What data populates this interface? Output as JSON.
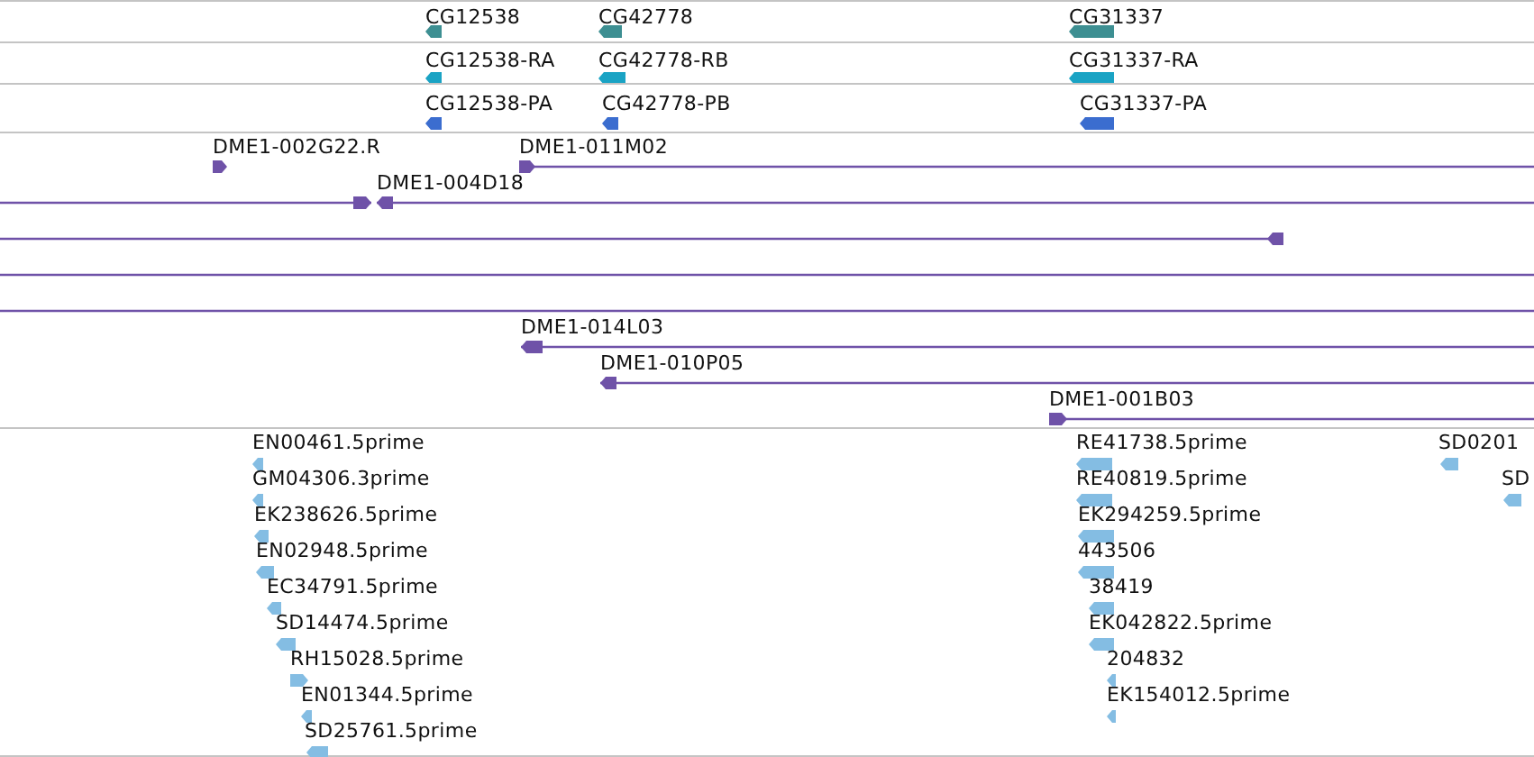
{
  "tracks": [
    {
      "kind": "gene",
      "features": [
        {
          "label": "CG12538",
          "reverse": true
        },
        {
          "label": "CG42778",
          "reverse": true
        },
        {
          "label": "CG31337",
          "reverse": true
        }
      ]
    },
    {
      "kind": "transcript",
      "features": [
        {
          "label": "CG12538-RA",
          "reverse": true
        },
        {
          "label": "CG42778-RB",
          "reverse": true
        },
        {
          "label": "CG31337-RA",
          "reverse": true
        }
      ]
    },
    {
      "kind": "protein",
      "features": [
        {
          "label": "CG12538-PA",
          "reverse": true
        },
        {
          "label": "CG42778-PB",
          "reverse": true
        },
        {
          "label": "CG31337-PA",
          "reverse": true
        }
      ]
    },
    {
      "kind": "clone",
      "features": [
        {
          "kind": "arrow",
          "label": "DME1-002G22.R",
          "reverse": false
        },
        {
          "kind": "arrow",
          "label": "DME1-011M02",
          "reverse": false
        },
        {
          "kind": "arrow",
          "reverse": false
        },
        {
          "kind": "arrow",
          "label": "DME1-004D18",
          "reverse": true
        },
        {
          "kind": "arrow",
          "reverse": true
        },
        {
          "kind": "line"
        },
        {
          "kind": "line"
        },
        {
          "kind": "arrow",
          "label": "DME1-014L03",
          "reverse": true
        },
        {
          "kind": "arrow",
          "label": "DME1-010P05",
          "reverse": true
        },
        {
          "kind": "arrow",
          "label": "DME1-001B03",
          "reverse": false
        }
      ]
    },
    {
      "kind": "est",
      "features": [
        {
          "label": "EN00461.5prime",
          "reverse": true
        },
        {
          "label": "GM04306.3prime",
          "reverse": true
        },
        {
          "label": "EK238626.5prime",
          "reverse": true
        },
        {
          "label": "EN02948.5prime",
          "reverse": true
        },
        {
          "label": "EC34791.5prime",
          "reverse": true
        },
        {
          "label": "SD14474.5prime",
          "reverse": true
        },
        {
          "label": "RH15028.5prime",
          "reverse": false
        },
        {
          "label": "EN01344.5prime",
          "reverse": true
        },
        {
          "label": "SD25761.5prime",
          "reverse": true
        },
        {
          "label": "RE41738.5prime",
          "reverse": true
        },
        {
          "label": "RE40819.5prime",
          "reverse": true
        },
        {
          "label": "EK294259.5prime",
          "reverse": true
        },
        {
          "label": "443506",
          "reverse": true
        },
        {
          "label": "38419",
          "reverse": true
        },
        {
          "label": "EK042822.5prime",
          "reverse": true
        },
        {
          "label": "204832",
          "reverse": true
        },
        {
          "label": "EK154012.5prime",
          "reverse": true
        },
        {
          "label": "SD0201",
          "reverse": true
        },
        {
          "label": "SD",
          "reverse": true
        }
      ]
    }
  ]
}
